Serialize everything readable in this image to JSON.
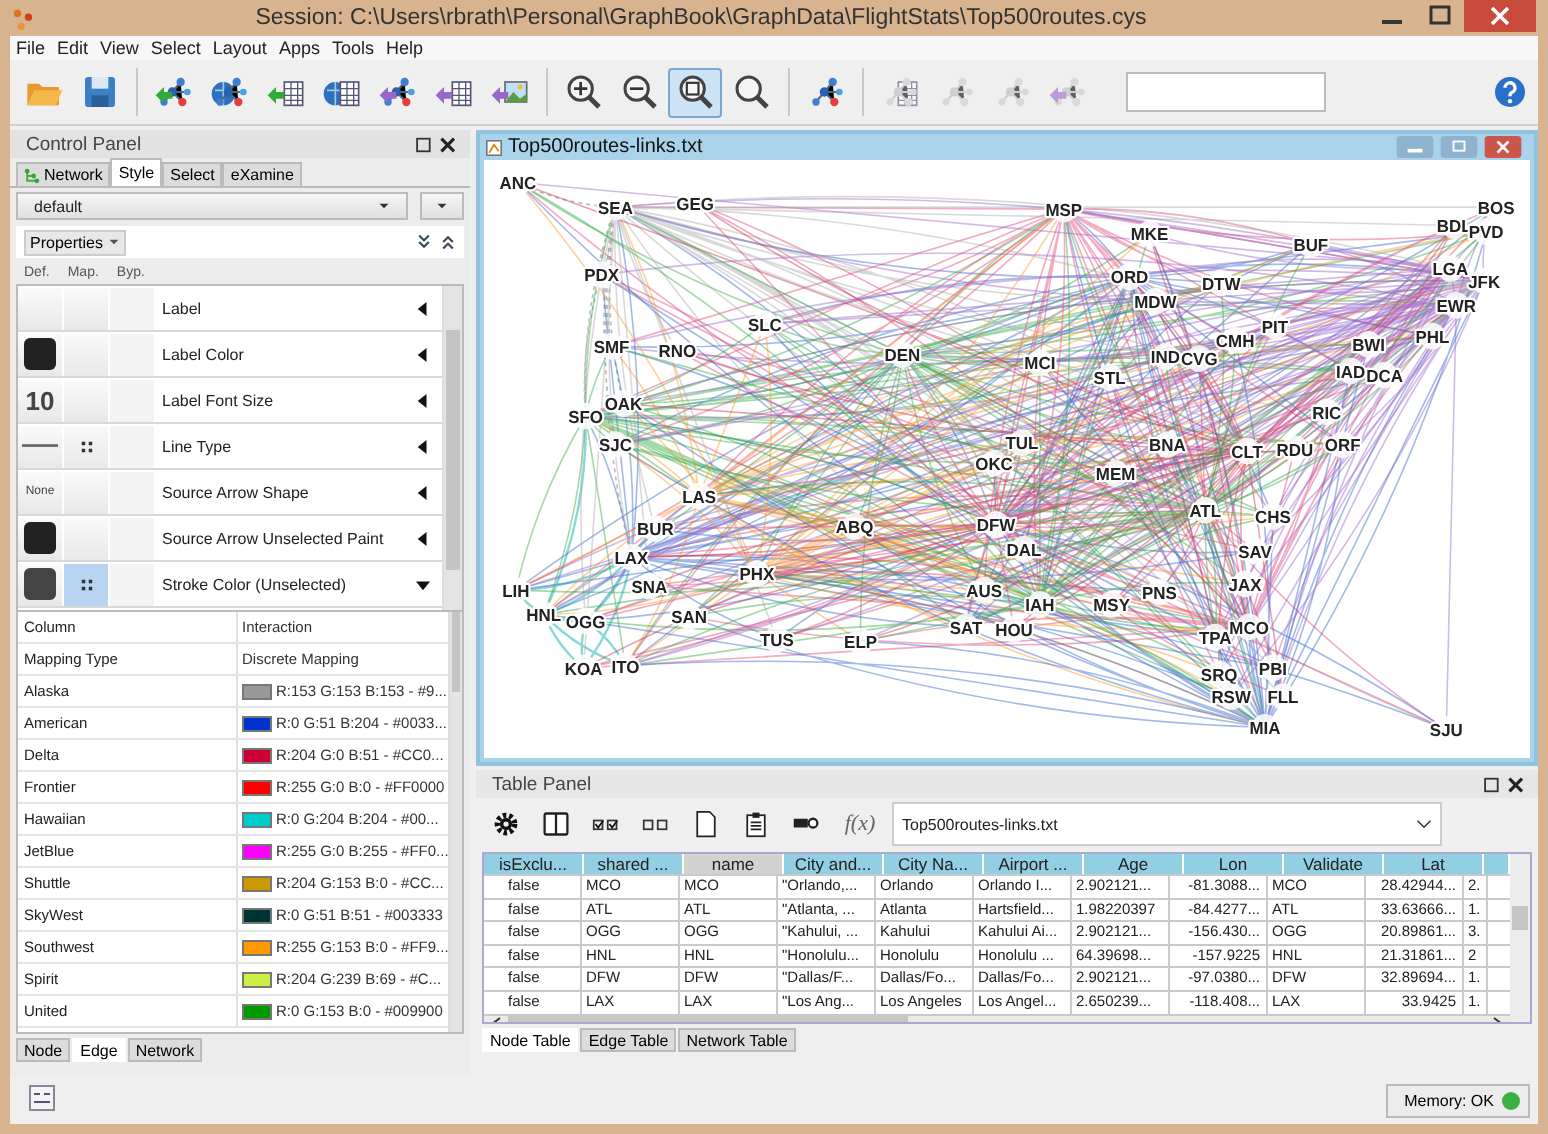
{
  "window": {
    "title": "Session: C:\\Users\\rbrath\\Personal\\GraphBook\\GraphData\\FlightStats\\Top500routes.cys"
  },
  "menu": [
    "File",
    "Edit",
    "View",
    "Select",
    "Layout",
    "Apps",
    "Tools",
    "Help"
  ],
  "toolbar": [
    [
      {
        "kind": "open",
        "selected": false,
        "disabled": false
      },
      {
        "kind": "save",
        "selected": false,
        "disabled": false
      }
    ],
    [
      {
        "kind": "import-network",
        "selected": false,
        "disabled": false
      },
      {
        "kind": "import-network-web",
        "selected": false,
        "disabled": false
      },
      {
        "kind": "import-table",
        "selected": false,
        "disabled": false
      },
      {
        "kind": "import-table-web",
        "selected": false,
        "disabled": false
      },
      {
        "kind": "export-network",
        "selected": false,
        "disabled": false
      },
      {
        "kind": "export-table",
        "selected": false,
        "disabled": false
      },
      {
        "kind": "export-image",
        "selected": false,
        "disabled": false
      }
    ],
    [
      {
        "kind": "zoom-in",
        "selected": false,
        "disabled": false
      },
      {
        "kind": "zoom-out",
        "selected": false,
        "disabled": false
      },
      {
        "kind": "zoom-fit",
        "selected": true,
        "disabled": false
      },
      {
        "kind": "zoom-selected",
        "selected": false,
        "disabled": false
      }
    ],
    [
      {
        "kind": "layout",
        "selected": false,
        "disabled": false
      }
    ],
    [
      {
        "kind": "hide-table",
        "selected": false,
        "disabled": true
      },
      {
        "kind": "network",
        "selected": false,
        "disabled": true
      },
      {
        "kind": "network",
        "selected": false,
        "disabled": true
      },
      {
        "kind": "export-network",
        "selected": false,
        "disabled": true
      }
    ]
  ],
  "control_panel": {
    "title": "Control Panel",
    "tabs": [
      {
        "label": "Network",
        "selected": false
      },
      {
        "label": "Style",
        "selected": true
      },
      {
        "label": "Select",
        "selected": false
      },
      {
        "label": "eXamine",
        "selected": false
      }
    ],
    "style_name": "default",
    "properties_label": "Properties",
    "columns": [
      "Def.",
      "Map.",
      "Byp."
    ],
    "properties": [
      {
        "label": "Label",
        "default": {
          "kind": "blank"
        },
        "mapped": false,
        "selected": false,
        "expanded": false
      },
      {
        "label": "Label Color",
        "default": {
          "kind": "swatch",
          "color": "#222222"
        },
        "mapped": false,
        "selected": false,
        "expanded": false
      },
      {
        "label": "Label Font Size",
        "default": {
          "kind": "text",
          "text": "10"
        },
        "mapped": false,
        "selected": false,
        "expanded": false
      },
      {
        "label": "Line Type",
        "default": {
          "kind": "line"
        },
        "mapped": true,
        "selected": false,
        "expanded": false
      },
      {
        "label": "Source Arrow Shape",
        "default": {
          "kind": "small-text",
          "text": "None"
        },
        "mapped": false,
        "selected": false,
        "expanded": false
      },
      {
        "label": "Source Arrow Unselected Paint",
        "default": {
          "kind": "swatch",
          "color": "#222222"
        },
        "mapped": false,
        "selected": false,
        "expanded": false
      },
      {
        "label": "Stroke Color (Unselected)",
        "default": {
          "kind": "swatch",
          "color": "#444444"
        },
        "mapped": true,
        "selected": true,
        "expanded": true
      }
    ],
    "mapping": [
      {
        "key": "Column",
        "value": "Interaction"
      },
      {
        "key": "Mapping Type",
        "value": "Discrete Mapping"
      },
      {
        "key": "Alaska",
        "color": "#999999",
        "value": "R:153 G:153 B:153 - #9..."
      },
      {
        "key": "American",
        "color": "#0033cc",
        "value": "R:0 G:51 B:204 - #0033..."
      },
      {
        "key": "Delta",
        "color": "#cc0033",
        "value": "R:204 G:0 B:51 - #CC0..."
      },
      {
        "key": "Frontier",
        "color": "#ff0000",
        "value": "R:255 G:0 B:0 - #FF0000"
      },
      {
        "key": "Hawaiian",
        "color": "#00cccc",
        "value": "R:0 G:204 B:204 - #00..."
      },
      {
        "key": "JetBlue",
        "color": "#ff00ff",
        "value": "R:255 G:0 B:255 - #FF0..."
      },
      {
        "key": "Shuttle",
        "color": "#cc9900",
        "value": "R:204 G:153 B:0 - #CC..."
      },
      {
        "key": "SkyWest",
        "color": "#003333",
        "value": "R:0 G:51 B:51 - #003333"
      },
      {
        "key": "Southwest",
        "color": "#ff9900",
        "value": "R:255 G:153 B:0 - #FF9..."
      },
      {
        "key": "Spirit",
        "color": "#ccef45",
        "value": "R:204 G:239 B:69 - #C..."
      },
      {
        "key": "United",
        "color": "#009900",
        "value": "R:0 G:153 B:0 - #009900"
      }
    ],
    "bottom_tabs": [
      {
        "label": "Node",
        "selected": false
      },
      {
        "label": "Edge",
        "selected": true
      },
      {
        "label": "Network",
        "selected": false
      }
    ]
  },
  "network": {
    "title": "Top500routes-links.txt",
    "nodes": [
      "ANC",
      "SEA",
      "GEG",
      "MSP",
      "BOS",
      "MKE",
      "BUF",
      "BDL",
      "PVD",
      "PDX",
      "ORD",
      "DTW",
      "LGA",
      "JFK",
      "MDW",
      "EWR",
      "SMF",
      "RNO",
      "SLC",
      "DEN",
      "MCI",
      "IND",
      "CVG",
      "CMH",
      "PIT",
      "BWI",
      "PHL",
      "STL",
      "IAD",
      "DCA",
      "OAK",
      "SFO",
      "RIC",
      "SJC",
      "TUL",
      "BNA",
      "CLT",
      "RDU",
      "ORF",
      "OKC",
      "MEM",
      "LAS",
      "ATL",
      "CHS",
      "BUR",
      "ABQ",
      "DFW",
      "LAX",
      "DAL",
      "SAV",
      "PHX",
      "LIH",
      "SNA",
      "AUS",
      "PNS",
      "JAX",
      "IAH",
      "MSY",
      "HNL",
      "OGG",
      "SAN",
      "SAT",
      "HOU",
      "MCO",
      "TUS",
      "ELP",
      "TPA",
      "KOA",
      "ITO",
      "PBI",
      "SRQ",
      "RSW",
      "FLL",
      "MIA",
      "SJU"
    ]
  },
  "table_panel": {
    "title": "Table Panel",
    "tools": [
      {
        "kind": "settings"
      },
      {
        "kind": "columns"
      },
      {
        "kind": "select-all"
      },
      {
        "kind": "select-none"
      },
      {
        "kind": "new"
      },
      {
        "kind": "delete"
      },
      {
        "kind": "link"
      },
      {
        "kind": "function",
        "label": "f(x)"
      }
    ],
    "table_select": "Top500routes-links.txt",
    "columns": [
      {
        "label": "isExclu...",
        "selected": false
      },
      {
        "label": "shared ...",
        "selected": false
      },
      {
        "label": "name",
        "selected": true
      },
      {
        "label": "City and...",
        "selected": false
      },
      {
        "label": "City Na...",
        "selected": false
      },
      {
        "label": "Airport ...",
        "selected": false
      },
      {
        "label": "Age",
        "selected": false
      },
      {
        "label": "Lon",
        "selected": false
      },
      {
        "label": "Validate",
        "selected": false
      },
      {
        "label": "Lat",
        "selected": false
      },
      {
        "selected": false
      }
    ],
    "rows": [
      [
        "false",
        "MCO",
        "MCO",
        "\"Orlando,...",
        "Orlando",
        "Orlando I...",
        "2.902121...",
        "-81.3088...",
        "MCO",
        "28.42944...",
        "2."
      ],
      [
        "false",
        "ATL",
        "ATL",
        "\"Atlanta, ...",
        "Atlanta",
        "Hartsfield...",
        "1.98220397",
        "-84.4277...",
        "ATL",
        "33.63666...",
        "1."
      ],
      [
        "false",
        "OGG",
        "OGG",
        "\"Kahului, ...",
        "Kahului",
        "Kahului Ai...",
        "2.902121...",
        "-156.430...",
        "OGG",
        "20.89861...",
        "3."
      ],
      [
        "false",
        "HNL",
        "HNL",
        "\"Honolulu...",
        "Honolulu",
        "Honolulu ...",
        "64.39698...",
        "-157.9225",
        "HNL",
        "21.31861...",
        "2"
      ],
      [
        "false",
        "DFW",
        "DFW",
        "\"Dallas/F...",
        "Dallas/Fo...",
        "Dallas/Fo...",
        "2.902121...",
        "-97.0380...",
        "DFW",
        "32.89694...",
        "1."
      ],
      [
        "false",
        "LAX",
        "LAX",
        "\"Los Ang...",
        "Los Angeles",
        "Los Angel...",
        "2.650239...",
        "-118.408...",
        "LAX",
        "33.9425",
        "1."
      ]
    ],
    "tabs": [
      {
        "label": "Node Table",
        "selected": true
      },
      {
        "label": "Edge Table",
        "selected": false
      },
      {
        "label": "Network Table",
        "selected": false
      }
    ]
  },
  "memory": {
    "label": "Memory: OK",
    "color": "#3cb043"
  }
}
